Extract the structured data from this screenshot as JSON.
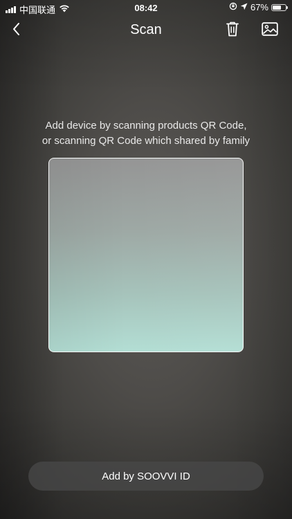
{
  "status_bar": {
    "carrier": "中国联通",
    "time": "08:42",
    "battery_percent": "67%",
    "battery_level": 0.67,
    "icons": [
      "cellular-signal-icon",
      "wifi-icon",
      "screen-rotation-lock-icon",
      "location-arrow-icon",
      "battery-icon"
    ]
  },
  "nav": {
    "title": "Scan",
    "back_icon": "chevron-left-icon",
    "trash_icon": "trash-icon",
    "gallery_icon": "image-icon"
  },
  "instructions": {
    "line1": "Add device by scanning products QR Code,",
    "line2": "or scanning QR Code which shared by family"
  },
  "bottom": {
    "add_button_label": "Add by SOOVVI ID"
  },
  "colors": {
    "frame_border": "#ffffff",
    "button_bg": "#484848",
    "text": "#ffffff"
  }
}
